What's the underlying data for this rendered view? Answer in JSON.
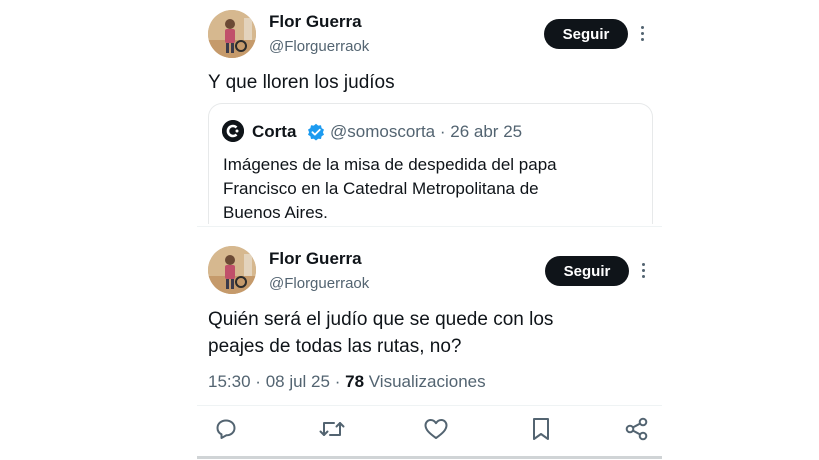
{
  "tweet1": {
    "name": "Flor Guerra",
    "handle": "@Florguerraok",
    "follow_label": "Seguir",
    "text": "Y que lloren los judíos",
    "quote": {
      "name": "Corta",
      "handle": "@somoscorta",
      "separator": "·",
      "date": "26 abr 25",
      "text_lines": [
        "Imágenes de la misa de despedida del papa",
        "Francisco en la Catedral Metropolitana de",
        "Buenos Aires."
      ]
    }
  },
  "tweet2": {
    "name": "Flor Guerra",
    "handle": "@Florguerraok",
    "follow_label": "Seguir",
    "text_lines": [
      "Quién será el judío que se quede con los",
      "peajes de todas las rutas, no?"
    ],
    "time": "15:30",
    "sep": "·",
    "date": "08 jul 25",
    "views_count": "78",
    "views_label": "Visualizaciones"
  },
  "actions": [
    "reply-icon",
    "retweet-icon",
    "like-icon",
    "bookmark-icon",
    "share-icon"
  ],
  "colors": {
    "text": "#0f1419",
    "secondary": "#536471",
    "verified": "#1d9bf0",
    "button": "#0f1419"
  }
}
